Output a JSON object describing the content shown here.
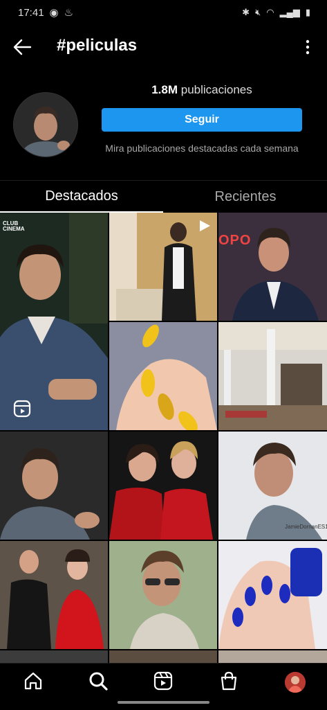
{
  "status_bar": {
    "time": "17:41"
  },
  "header": {
    "title": "#peliculas",
    "back_icon": "arrow-left-icon",
    "menu_icon": "more-vertical-icon"
  },
  "profile": {
    "post_count": "1.8M",
    "post_label": "publicaciones",
    "follow_label": "Seguir",
    "note": "Mira publicaciones destacadas cada semana"
  },
  "tabs": [
    {
      "label": "Destacados",
      "active": true
    },
    {
      "label": "Recientes",
      "active": false
    }
  ],
  "posts": [
    {
      "overlay_text": "CLUB\nCINEMA",
      "icon": "reels-icon"
    },
    {
      "overlay_text": "",
      "icon": "play-icon"
    },
    {
      "overlay_text": "OPO",
      "icon": ""
    },
    {
      "overlay_text": "",
      "icon": ""
    },
    {
      "overlay_text": "",
      "icon": ""
    },
    {
      "overlay_text": "",
      "icon": ""
    },
    {
      "overlay_text": "",
      "icon": ""
    },
    {
      "overlay_text": "JamieDornanES1",
      "icon": ""
    },
    {
      "overlay_text": "",
      "icon": ""
    },
    {
      "overlay_text": "",
      "icon": ""
    },
    {
      "overlay_text": "",
      "icon": ""
    }
  ],
  "bottom_nav": [
    {
      "name": "home-icon"
    },
    {
      "name": "search-icon",
      "active": true
    },
    {
      "name": "reels-icon"
    },
    {
      "name": "shop-icon"
    },
    {
      "name": "profile-avatar"
    }
  ],
  "colors": {
    "accent": "#1d96f0",
    "background": "#000000"
  }
}
